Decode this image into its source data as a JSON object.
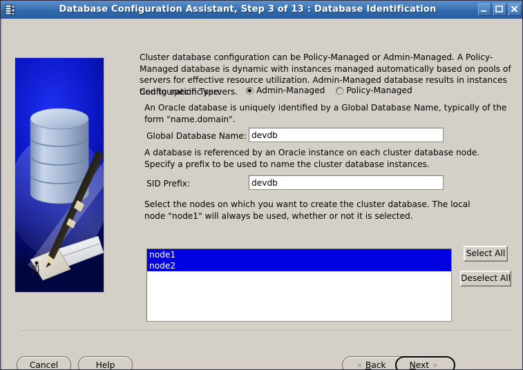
{
  "window": {
    "title": "Database Configuration Assistant, Step 3 of 13 : Database Identification",
    "icon": "database-list-icon",
    "controls": {
      "minimize": "minimize-icon",
      "maximize": "maximize-icon",
      "close": "close-icon"
    }
  },
  "illustration": {
    "name": "database-and-pen-illustration",
    "background_color": "#0b18c8"
  },
  "main": {
    "intro_paragraph": "Cluster database configuration can be Policy-Managed or Admin-Managed. A Policy-Managed database is dynamic with instances managed automatically based on pools of servers for effective resource utilization. Admin-Managed database results in instances tied to specific servers.",
    "configuration_type": {
      "label": "Configuration Type:",
      "options": [
        {
          "label": "Admin-Managed",
          "selected": true
        },
        {
          "label": "Policy-Managed",
          "selected": false
        }
      ]
    },
    "global_db": {
      "description": "An Oracle database is uniquely identified by a Global Database Name, typically of the form \"name.domain\".",
      "label": "Global Database Name:",
      "value": "devdb",
      "placeholder": ""
    },
    "sid_prefix": {
      "description": "A database is referenced by an Oracle instance on each cluster database node. Specify a prefix to be used to name the cluster database instances.",
      "label": "SID Prefix:",
      "value": "devdb",
      "placeholder": ""
    },
    "nodes": {
      "description": "Select the nodes on which you want to create the cluster database. The local node \"node1\" will always be used, whether or not it is selected.",
      "items": [
        {
          "label": "node1",
          "selected": true
        },
        {
          "label": "node2",
          "selected": true
        }
      ],
      "select_all_label": "Select All",
      "deselect_all_label": "Deselect All",
      "selection_color": "#0000e0"
    }
  },
  "footer": {
    "cancel_label": "Cancel",
    "help_label": "Help",
    "back_label": "Back",
    "back_mnemonic": "B",
    "next_label": "Next",
    "next_mnemonic": "N",
    "back_chevron": "«",
    "next_chevron": "»"
  }
}
